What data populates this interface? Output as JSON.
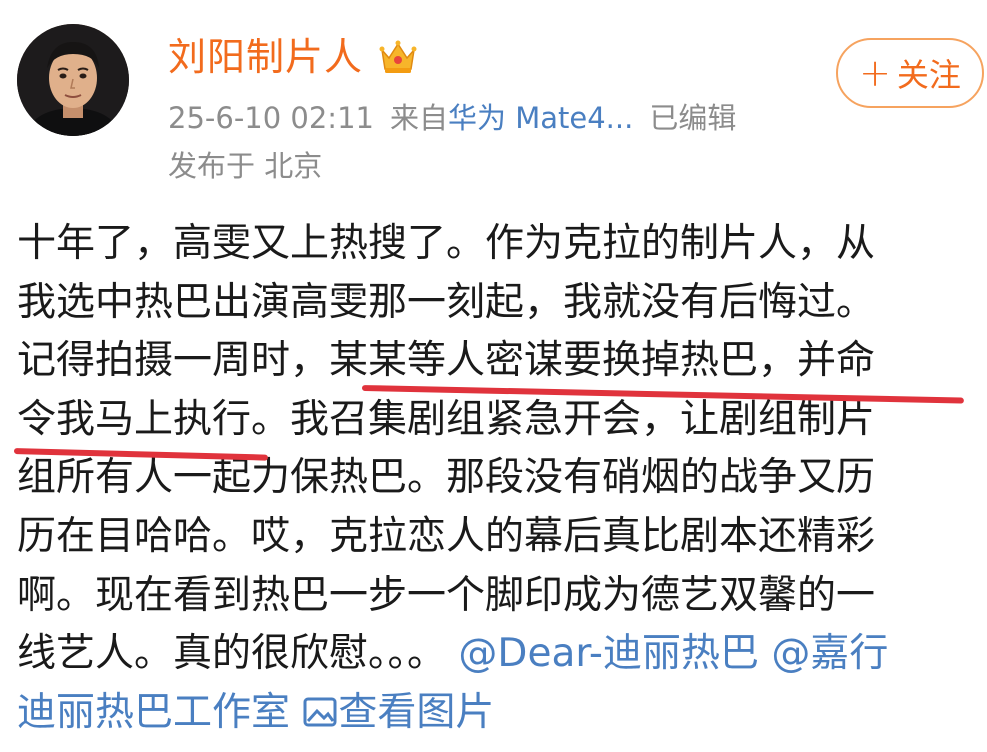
{
  "user": {
    "name": "刘阳制片人"
  },
  "follow_button": {
    "plus": "+",
    "label": "关注"
  },
  "meta": {
    "timestamp": "25-6-10 02:11",
    "source_prefix": "来自",
    "device": "华为 Mate4...",
    "edited": "已编辑"
  },
  "location": "发布于 北京",
  "post": {
    "lines": [
      "十年了，高雯又上热搜了。作为克拉的制片人，从",
      "我选中热巴出演高雯那一刻起，我就没有后悔过。",
      "记得拍摄一周时，某某等人密谋要换掉热巴，并命",
      "令我马上执行。我召集剧组紧急开会，让剧组制片",
      "组所有人一起力保热巴。那段没有硝烟的战争又历",
      "历在目哈哈。哎，克拉恋人的幕后真比剧本还精彩",
      "啊。现在看到热巴一步一个脚印成为德艺双馨的一"
    ],
    "line8_text": "线艺人。真的很欣慰。。。",
    "mention_1": "@Dear-迪丽热巴",
    "mention_2_part1": "@嘉行",
    "line9_mention": "迪丽热巴工作室",
    "view_image": "查看图片"
  },
  "colors": {
    "username": "#f26b1d",
    "link": "#4a7fc1",
    "meta": "#8c8c8c",
    "underline": "#e0333c"
  },
  "icons": [
    "crown-icon",
    "image-icon",
    "avatar"
  ]
}
